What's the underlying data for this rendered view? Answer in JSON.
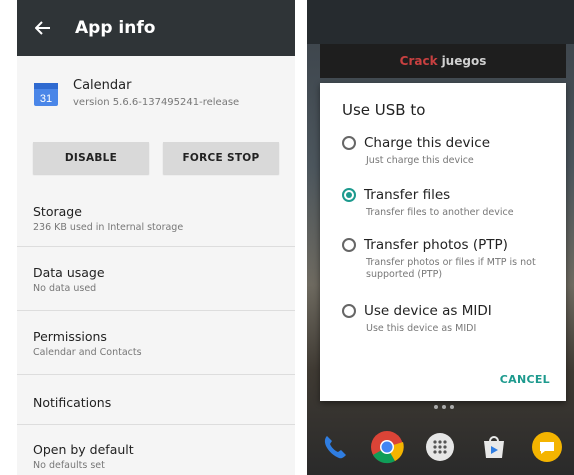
{
  "left": {
    "header": {
      "title": "App info"
    },
    "app": {
      "name": "Calendar",
      "version": "version 5.6.6-137495241-release",
      "icon_number": "31"
    },
    "buttons": {
      "disable": "DISABLE",
      "force_stop": "FORCE STOP"
    },
    "items": [
      {
        "title": "Storage",
        "subtitle": "236 KB used in Internal storage"
      },
      {
        "title": "Data usage",
        "subtitle": "No data used"
      },
      {
        "title": "Permissions",
        "subtitle": "Calendar and Contacts"
      },
      {
        "title": "Notifications",
        "subtitle": ""
      },
      {
        "title": "Open by default",
        "subtitle": "No defaults set"
      }
    ]
  },
  "right": {
    "banner": {
      "part1": "Crack",
      "part2": "juegos"
    },
    "dialog": {
      "title": "Use USB to",
      "options": [
        {
          "label": "Charge this device",
          "sub": "Just charge this device",
          "selected": false
        },
        {
          "label": "Transfer files",
          "sub": "Transfer files to another device",
          "selected": true
        },
        {
          "label": "Transfer photos (PTP)",
          "sub": "Transfer photos or files if MTP is not supported (PTP)",
          "selected": false
        },
        {
          "label": "Use device as MIDI",
          "sub": "Use this device as MIDI",
          "selected": false
        }
      ],
      "cancel": "CANCEL"
    },
    "dock_icons": [
      "phone-icon",
      "chrome-icon",
      "app-drawer-icon",
      "store-icon",
      "messages-icon"
    ]
  },
  "colors": {
    "accent": "#1d9a8e",
    "toolbar": "#2f3437"
  }
}
